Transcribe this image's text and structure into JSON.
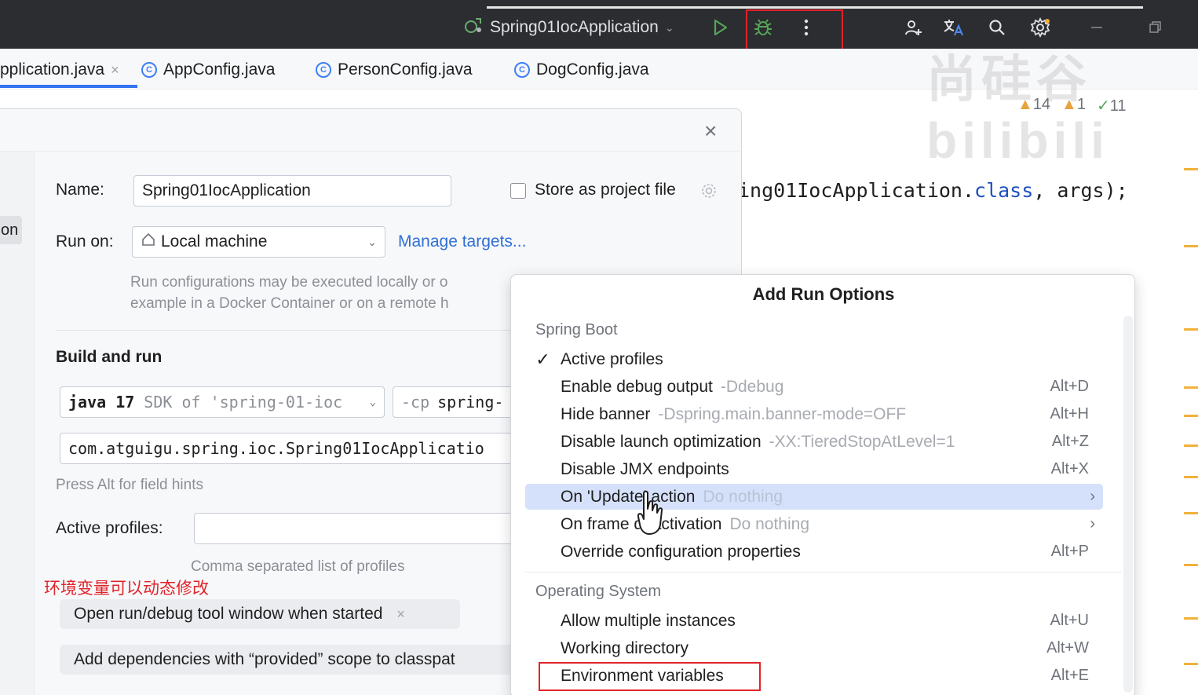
{
  "titlebar": {
    "run_config": "Spring01IocApplication",
    "icons": [
      "run-icon",
      "debug-icon",
      "more-vert-icon",
      "add-user-icon",
      "translate-icon",
      "search-icon",
      "settings-icon",
      "minimize-icon",
      "restore-icon"
    ]
  },
  "tabs": [
    {
      "label": "pplication.java",
      "active": true
    },
    {
      "label": "AppConfig.java"
    },
    {
      "label": "PersonConfig.java"
    },
    {
      "label": "DogConfig.java"
    }
  ],
  "editor": {
    "code_prefix": "ing01IocApplication.",
    "code_kw": "class",
    "code_suffix": ", args);",
    "inspect_warnings": "14",
    "inspect_weak": "1",
    "inspect_ok": "11"
  },
  "dialog": {
    "left_selected": "on",
    "name_label": "Name:",
    "name_value": "Spring01IocApplication",
    "store_label": "Store as project file",
    "run_on_label": "Run on:",
    "run_on_value": "Local machine",
    "manage_targets": "Manage targets...",
    "run_on_hint_1": "Run configurations may be executed locally or o",
    "run_on_hint_2": "example in a Docker Container or on a remote h",
    "build_run_title": "Build and run",
    "sdk_strong": "java 17",
    "sdk_weak": "SDK of 'spring-01-ioc",
    "cp_weak": "-cp",
    "cp_strong": "spring-",
    "main_class": "com.atguigu.spring.ioc.Spring01IocApplicatio",
    "field_hint": "Press Alt for field hints",
    "profiles_label": "Active profiles:",
    "profiles_hint": "Comma separated list of profiles",
    "chip_1": "Open run/debug tool window when started",
    "chip_2": "Add dependencies with “provided” scope to classpat"
  },
  "annotation": "环境变量可以动态修改",
  "popup": {
    "title": "Add Run Options",
    "group_spring": "Spring Boot",
    "group_os": "Operating System",
    "items": [
      {
        "label": "Active profiles",
        "checked": "✓"
      },
      {
        "label": "Enable debug output",
        "sub": "-Ddebug",
        "shortcut": "Alt+D"
      },
      {
        "label": "Hide banner",
        "sub": "-Dspring.main.banner-mode=OFF",
        "shortcut": "Alt+H"
      },
      {
        "label": "Disable launch optimization",
        "sub": "-XX:TieredStopAtLevel=1",
        "shortcut": "Alt+Z"
      },
      {
        "label": "Disable JMX endpoints",
        "shortcut": "Alt+X"
      },
      {
        "label": "On 'Update' action",
        "sub": "Do nothing",
        "arrow": "›"
      },
      {
        "label": "On frame deactivation",
        "sub": "Do nothing",
        "arrow": "›"
      },
      {
        "label": "Override configuration properties",
        "shortcut": "Alt+P"
      },
      {
        "label": "Allow multiple instances",
        "shortcut": "Alt+U"
      },
      {
        "label": "Working directory",
        "shortcut": "Alt+W"
      },
      {
        "label": "Environment variables",
        "shortcut": "Alt+E"
      }
    ]
  },
  "colors": {
    "titlebar_bg": "#2b2d30",
    "accent": "#3574f0",
    "highlight": "#d5e1fb",
    "annotation_red": "#e0242b"
  }
}
